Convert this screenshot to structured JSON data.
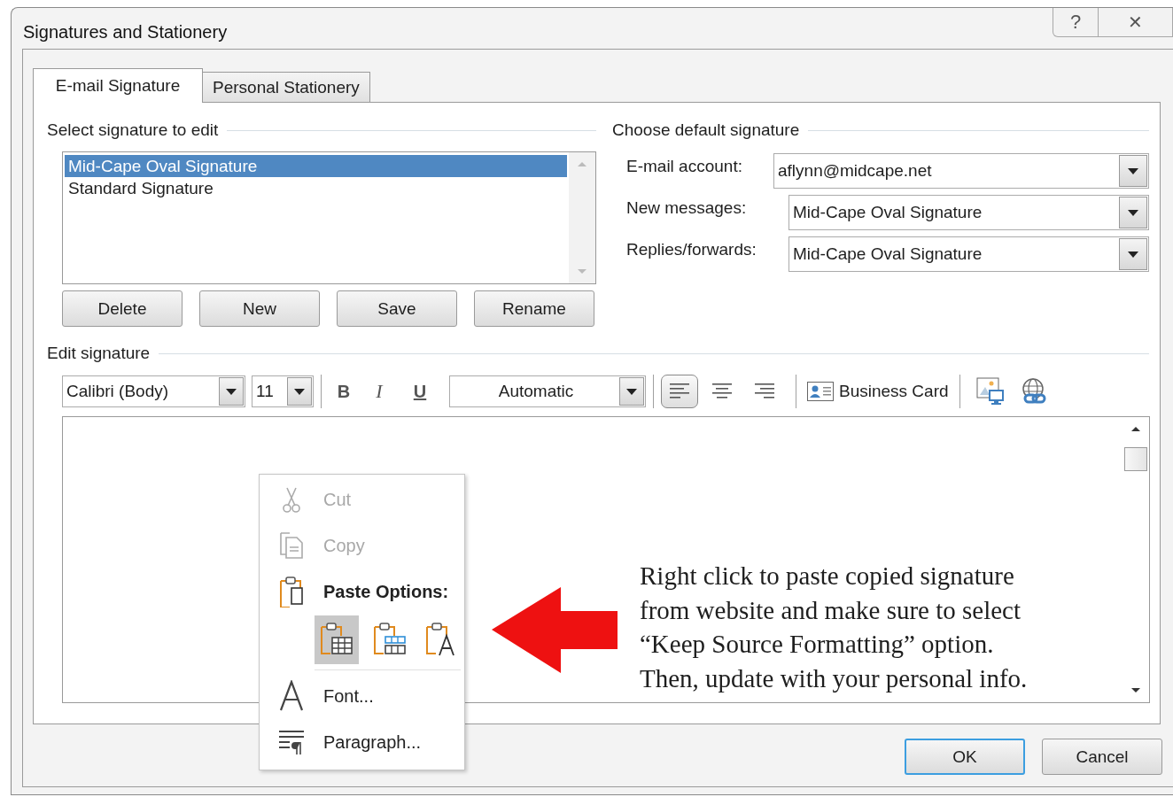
{
  "window": {
    "title": "Signatures and Stationery",
    "title_buttons": [
      {
        "kind": "help",
        "label": "?"
      },
      {
        "kind": "close",
        "label": "✕"
      }
    ]
  },
  "tabs": [
    {
      "label": "E-mail Signature",
      "selected": true
    },
    {
      "label": "Personal Stationery",
      "selected": false
    }
  ],
  "select_signature": {
    "label": "Select signature to edit",
    "items": [
      {
        "label": "Mid-Cape Oval Signature",
        "selected": true
      },
      {
        "label": "Standard Signature",
        "selected": false
      }
    ],
    "buttons": [
      "Delete",
      "New",
      "Save",
      "Rename"
    ]
  },
  "default_signature": {
    "label": "Choose default signature",
    "fields": [
      {
        "kind": "account",
        "label": "E-mail account:",
        "value": "aflynn@midcape.net"
      },
      {
        "kind": "signature",
        "label": "New messages:",
        "value": "Mid-Cape Oval Signature"
      },
      {
        "kind": "signature",
        "label": "Replies/forwards:",
        "value": "Mid-Cape Oval Signature"
      }
    ]
  },
  "edit_signature": {
    "label": "Edit signature",
    "toolbar": [
      {
        "kind": "font",
        "value": "Calibri (Body)"
      },
      {
        "kind": "size",
        "value": "11"
      },
      {
        "kind": "separator"
      },
      {
        "kind": "bold",
        "label": "B"
      },
      {
        "kind": "italic",
        "label": "I"
      },
      {
        "kind": "underline",
        "label": "U"
      },
      {
        "kind": "color",
        "value": "Automatic"
      },
      {
        "kind": "separator"
      },
      {
        "kind": "align_left",
        "selected": true
      },
      {
        "kind": "align_center",
        "selected": false
      },
      {
        "kind": "align_right",
        "selected": false
      },
      {
        "kind": "separator"
      },
      {
        "kind": "business_card",
        "label": "Business Card"
      },
      {
        "kind": "separator"
      },
      {
        "kind": "picture"
      },
      {
        "kind": "hyperlink"
      }
    ]
  },
  "context_menu": {
    "items": [
      {
        "kind": "cut",
        "label": "Cut",
        "disabled": true
      },
      {
        "kind": "copy",
        "label": "Copy",
        "disabled": true
      },
      {
        "kind": "paste_header",
        "label": "Paste Options:"
      },
      {
        "kind": "paste_options",
        "options": [
          {
            "kind": "keep_source",
            "selected": true
          },
          {
            "kind": "merge",
            "selected": false
          },
          {
            "kind": "text_only",
            "selected": false
          }
        ]
      },
      {
        "kind": "separator"
      },
      {
        "kind": "font",
        "label": "Font...",
        "disabled": false
      },
      {
        "kind": "paragraph",
        "label": "Paragraph...",
        "disabled": false
      }
    ]
  },
  "annotation": {
    "text": "Right click to paste copied signature\nfrom website and make sure to select\n“Keep Source Formatting” option.\nThen, update with your personal info."
  },
  "dialog_buttons": [
    {
      "label": "OK",
      "default": true
    },
    {
      "label": "Cancel",
      "default": false
    }
  ]
}
